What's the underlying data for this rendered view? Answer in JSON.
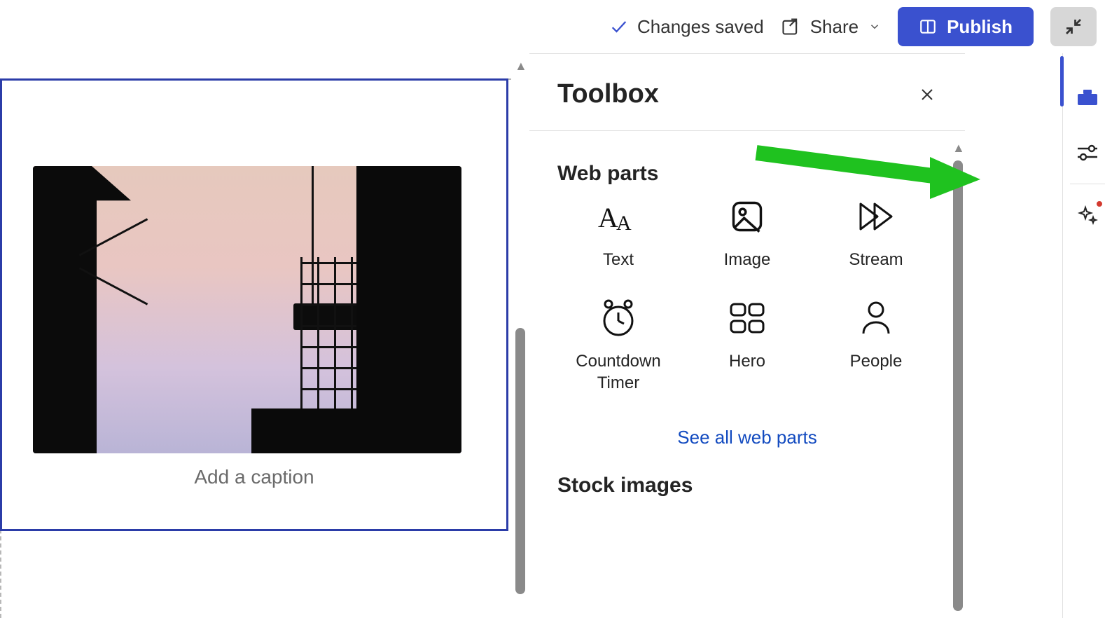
{
  "topbar": {
    "status": "Changes saved",
    "share": "Share",
    "publish": "Publish"
  },
  "canvas": {
    "caption_placeholder": "Add a caption"
  },
  "panel": {
    "title": "Toolbox",
    "sections": {
      "webparts": {
        "heading": "Web parts",
        "items": [
          {
            "label": "Text",
            "icon": "text"
          },
          {
            "label": "Image",
            "icon": "image"
          },
          {
            "label": "Stream",
            "icon": "stream"
          },
          {
            "label": "Countdown Timer",
            "icon": "clock"
          },
          {
            "label": "Hero",
            "icon": "hero"
          },
          {
            "label": "People",
            "icon": "people"
          }
        ],
        "see_all": "See all web parts"
      },
      "stock": {
        "heading": "Stock images"
      }
    }
  }
}
